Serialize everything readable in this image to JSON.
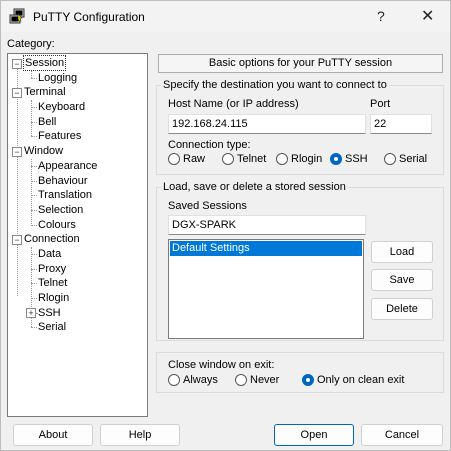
{
  "window": {
    "title": "PuTTY Configuration",
    "help_glyph": "?",
    "close_glyph": "✕"
  },
  "category": {
    "label": "Category:",
    "items": [
      {
        "label": "Session"
      },
      {
        "label": "Logging"
      },
      {
        "label": "Terminal"
      },
      {
        "label": "Keyboard"
      },
      {
        "label": "Bell"
      },
      {
        "label": "Features"
      },
      {
        "label": "Window"
      },
      {
        "label": "Appearance"
      },
      {
        "label": "Behaviour"
      },
      {
        "label": "Translation"
      },
      {
        "label": "Selection"
      },
      {
        "label": "Colours"
      },
      {
        "label": "Connection"
      },
      {
        "label": "Data"
      },
      {
        "label": "Proxy"
      },
      {
        "label": "Telnet"
      },
      {
        "label": "Rlogin"
      },
      {
        "label": "SSH"
      },
      {
        "label": "Serial"
      }
    ],
    "collapse_glyph": "−",
    "expand_glyph": "+"
  },
  "panel": {
    "header": "Basic options for your PuTTY session",
    "destination": {
      "title": "Specify the destination you want to connect to",
      "host_label": "Host Name (or IP address)",
      "host_value": "192.168.24.115",
      "port_label": "Port",
      "port_value": "22",
      "conn_type_label": "Connection type:",
      "conn_types": [
        {
          "label": "Raw"
        },
        {
          "label": "Telnet"
        },
        {
          "label": "Rlogin"
        },
        {
          "label": "SSH"
        },
        {
          "label": "Serial"
        }
      ],
      "selected_conn_type": "SSH"
    },
    "sessions": {
      "title": "Load, save or delete a stored session",
      "saved_label": "Saved Sessions",
      "saved_value": "DGX-SPARK",
      "list": [
        "Default Settings"
      ],
      "load_label": "Load",
      "save_label": "Save",
      "delete_label": "Delete"
    },
    "close_exit": {
      "label": "Close window on exit:",
      "options": [
        {
          "label": "Always"
        },
        {
          "label": "Never"
        },
        {
          "label": "Only on clean exit"
        }
      ],
      "selected": "Only on clean exit"
    }
  },
  "footer": {
    "about_label": "About",
    "help_label": "Help",
    "open_label": "Open",
    "cancel_label": "Cancel"
  },
  "colors": {
    "accent": "#0067c0",
    "selection": "#0078d7"
  }
}
